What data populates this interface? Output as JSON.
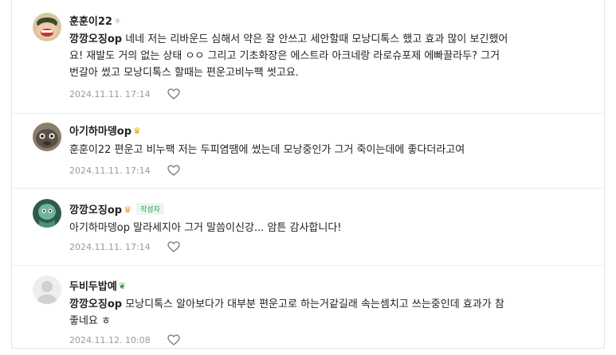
{
  "comments": [
    {
      "author": "훈훈이22",
      "author_badge": "✳",
      "lines": [
        {
          "mention": "깡깡오징op",
          "text": " 네네 저는 리바운드 심해서 약은 잘 안쓰고 세안할때 모낭디톡스 했고 효과 많이 보긴했어"
        },
        {
          "mention": "",
          "text": "요! 재발도 거의 없는 상태 ㅇㅇ 그리고 기초화장은 에스트라 아크네랑 라로슈포제 에빠끌라두? 그거"
        },
        {
          "mention": "",
          "text": "번갈아 썼고 모낭디톡스 할때는 편운고비누팩 썻고요."
        }
      ],
      "date": "2024.11.11. 17:14",
      "like_icon": "heart-icon"
    },
    {
      "author": "아기하마뎅op",
      "author_badge": "♛",
      "lines": [
        {
          "mention": "",
          "text": "훈훈이22 편운고 비누팩 저는 두피염땜에 썼는데 모낭중인가 그거 죽이는데에 좋다더라고여"
        }
      ],
      "date": "2024.11.11. 17:14",
      "like_icon": "heart-icon"
    },
    {
      "author": "깡깡오징op",
      "author_badge": "♛",
      "tag": "작성자",
      "lines": [
        {
          "mention": "",
          "text": "아기하마뎅op 말라세지아 그거 말씀이신강... 암튼 감사합니다!"
        }
      ],
      "date": "2024.11.11. 17:14",
      "like_icon": "heart-icon"
    },
    {
      "author": "두비두밥예",
      "author_badge": "❦",
      "lines": [
        {
          "mention": "깡깡오징op",
          "text": " 모낭디톡스 알아보다가 대부분 편운고로 하는거같길래 속는셈치고 쓰는중인데 효과가 참"
        },
        {
          "mention": "",
          "text": "좋네요 ㅎ"
        }
      ],
      "date": "2024.11.12. 10:08",
      "like_icon": "heart-icon"
    }
  ],
  "colors": {
    "text": "#222222",
    "meta": "#9a9a9a",
    "tag_bg": "#e9f7ee",
    "tag_text": "#2d9a56",
    "badge": "#e0a21b",
    "badge_green": "#3a9a3a"
  }
}
